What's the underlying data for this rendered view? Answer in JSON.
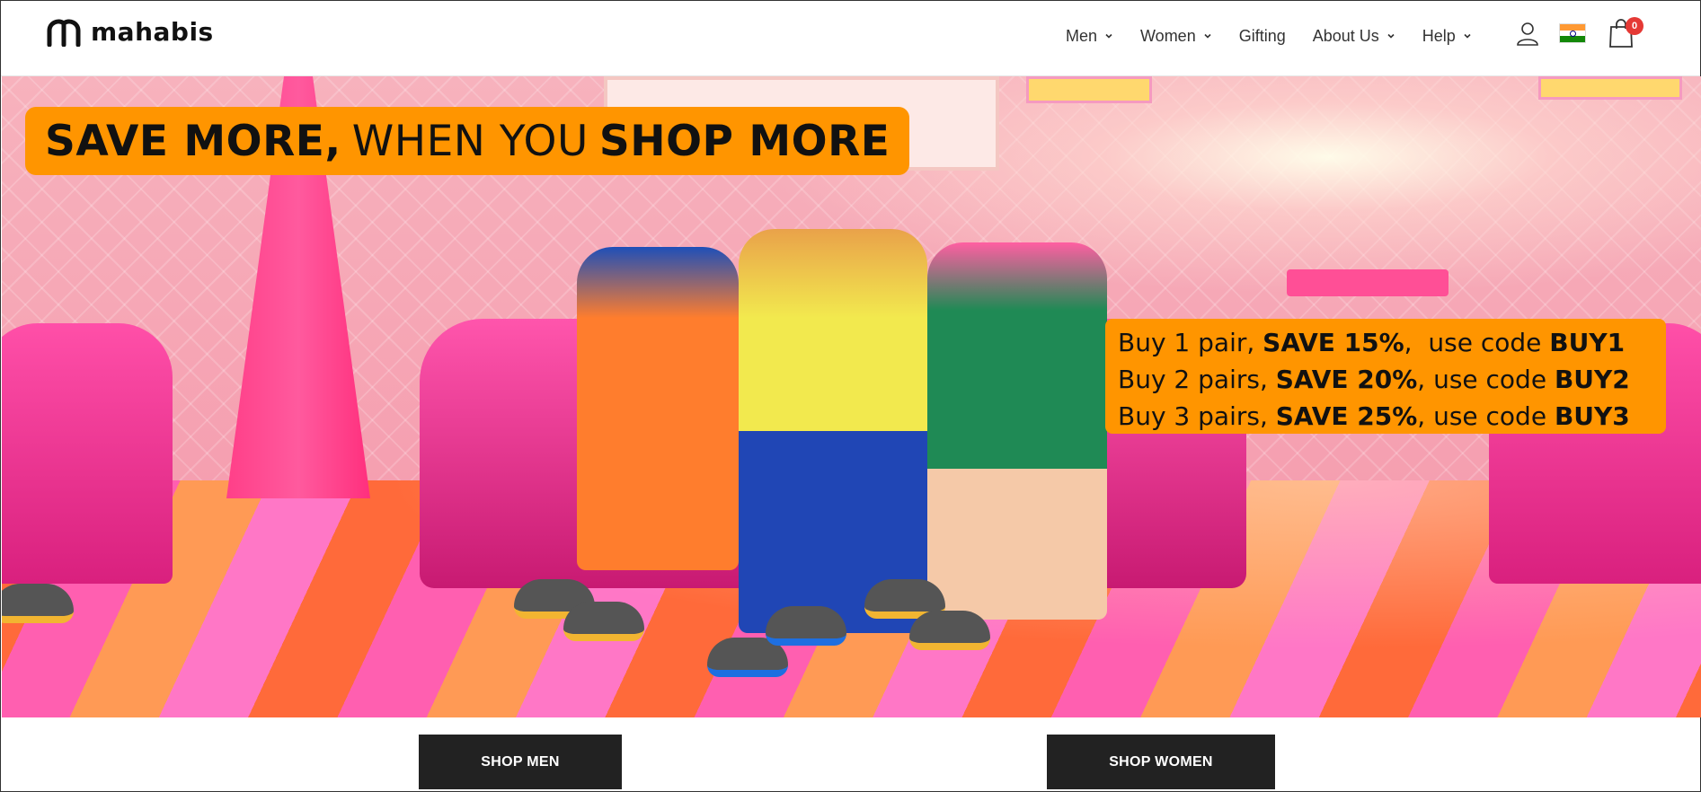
{
  "header": {
    "brand": "mahabis",
    "nav": [
      {
        "label": "Men",
        "has_dropdown": true
      },
      {
        "label": "Women",
        "has_dropdown": true
      },
      {
        "label": "Gifting",
        "has_dropdown": false
      },
      {
        "label": "About Us",
        "has_dropdown": true
      },
      {
        "label": "Help",
        "has_dropdown": true
      }
    ],
    "icons": {
      "account": "user-icon",
      "region": "india-flag-icon",
      "cart": "shopping-bag-icon"
    },
    "cart_count": "0"
  },
  "hero": {
    "headline": {
      "part1": "SAVE MORE,",
      "part2": "WHEN YOU",
      "part3": "SHOP MORE"
    },
    "promo": [
      {
        "pre": "Buy 1 pair, ",
        "save": "SAVE 15%",
        "mid": ",  use code ",
        "code": "BUY1"
      },
      {
        "pre": "Buy 2 pairs, ",
        "save": "SAVE 20%",
        "mid": ", use code ",
        "code": "BUY2"
      },
      {
        "pre": "Buy 3 pairs, ",
        "save": "SAVE 25%",
        "mid": ", use code ",
        "code": "BUY3"
      }
    ]
  },
  "cta": {
    "men": "SHOP MEN",
    "women": "SHOP WOMEN"
  },
  "colors": {
    "accent": "#ff9500",
    "button": "#222222",
    "badge": "#e53935"
  }
}
